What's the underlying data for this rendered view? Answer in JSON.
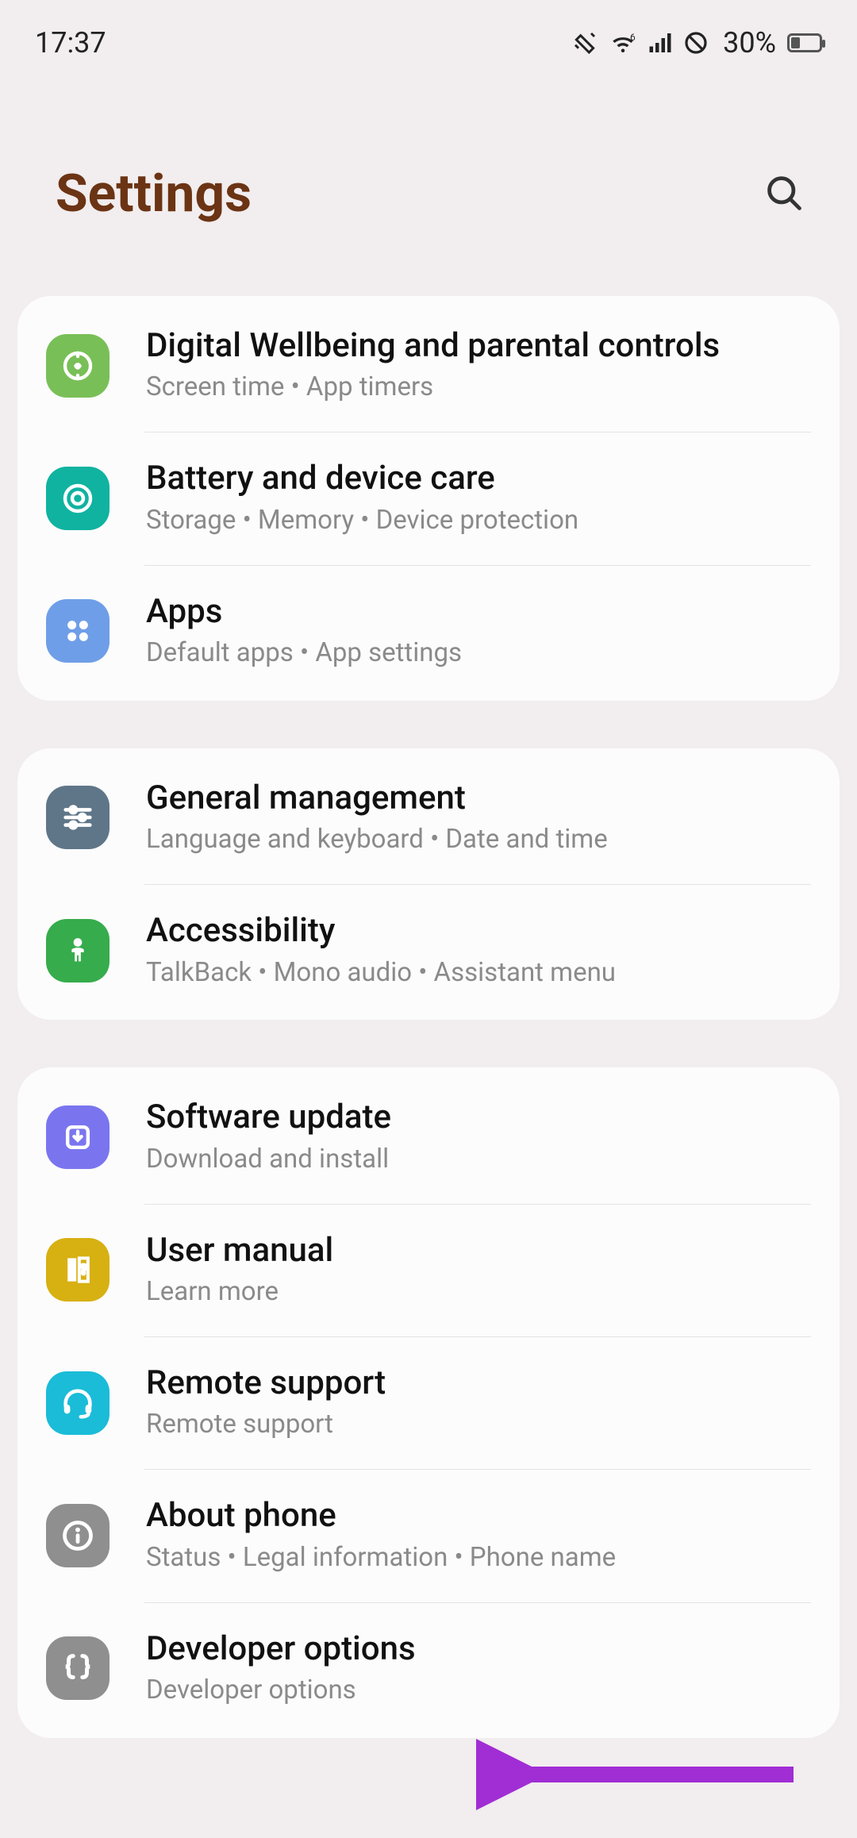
{
  "status": {
    "time": "17:37",
    "battery_pct": "30%"
  },
  "header": {
    "title": "Settings"
  },
  "groups": [
    {
      "items": [
        {
          "id": "digital-wellbeing",
          "title": "Digital Wellbeing and parental controls",
          "sub": "Screen time  •  App timers",
          "icon": "wellbeing-icon",
          "color": "c-green1"
        },
        {
          "id": "battery-device-care",
          "title": "Battery and device care",
          "sub": "Storage  •  Memory  •  Device protection",
          "icon": "device-care-icon",
          "color": "c-teal"
        },
        {
          "id": "apps",
          "title": "Apps",
          "sub": "Default apps  •  App settings",
          "icon": "apps-icon",
          "color": "c-blue1"
        }
      ]
    },
    {
      "items": [
        {
          "id": "general-management",
          "title": "General management",
          "sub": "Language and keyboard  •  Date and time",
          "icon": "sliders-icon",
          "color": "c-slate"
        },
        {
          "id": "accessibility",
          "title": "Accessibility",
          "sub": "TalkBack  •  Mono audio  •  Assistant menu",
          "icon": "person-icon",
          "color": "c-green2"
        }
      ]
    },
    {
      "items": [
        {
          "id": "software-update",
          "title": "Software update",
          "sub": "Download and install",
          "icon": "update-icon",
          "color": "c-indigo"
        },
        {
          "id": "user-manual",
          "title": "User manual",
          "sub": "Learn more",
          "icon": "book-icon",
          "color": "c-gold"
        },
        {
          "id": "remote-support",
          "title": "Remote support",
          "sub": "Remote support",
          "icon": "headset-icon",
          "color": "c-cyan"
        },
        {
          "id": "about-phone",
          "title": "About phone",
          "sub": "Status  •  Legal information  •  Phone name",
          "icon": "info-icon",
          "color": "c-grey"
        },
        {
          "id": "developer-options",
          "title": "Developer options",
          "sub": "Developer options",
          "icon": "braces-icon",
          "color": "c-grey"
        }
      ]
    }
  ],
  "annotation": {
    "arrow_color": "#a12dd5",
    "target": "developer-options"
  }
}
